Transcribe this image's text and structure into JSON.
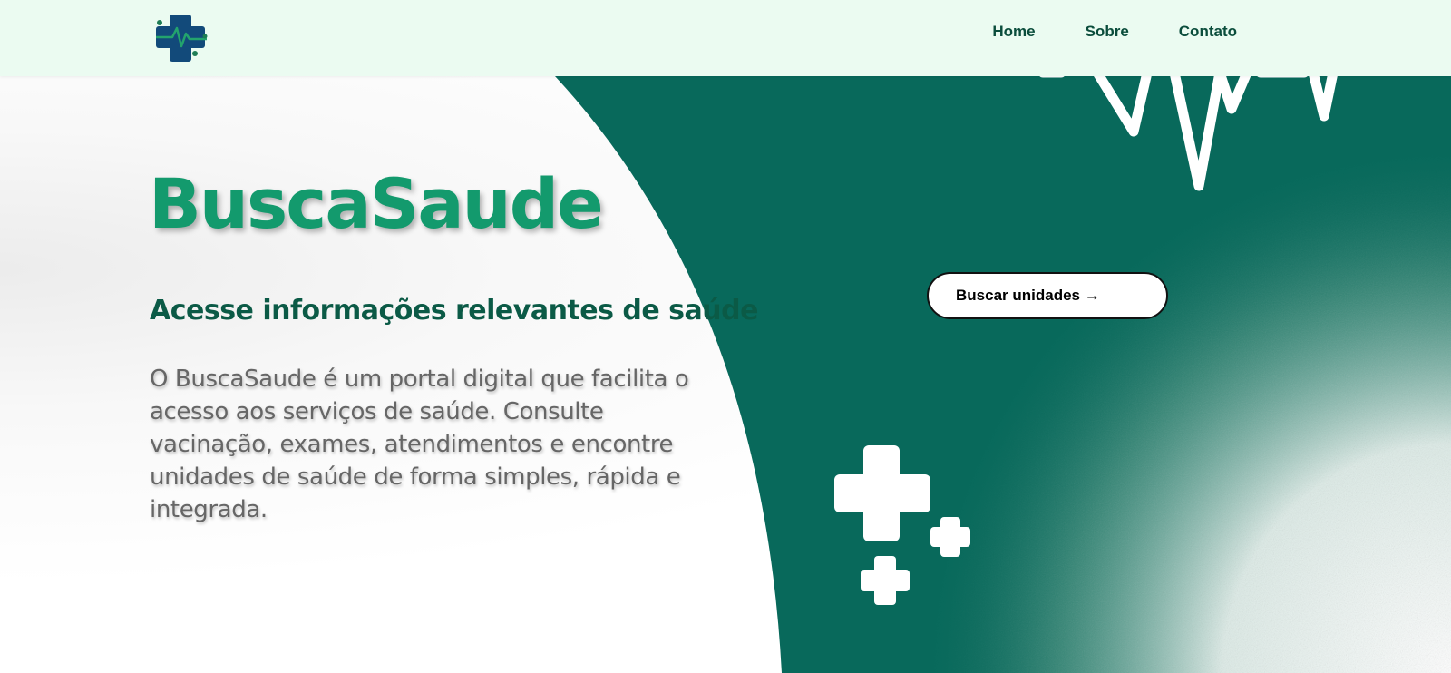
{
  "header": {
    "logo_icon": "medical-cross-heartbeat-icon",
    "nav": [
      {
        "label": "Home"
      },
      {
        "label": "Sobre"
      },
      {
        "label": "Contato"
      }
    ]
  },
  "hero": {
    "title": "BuscaSaude",
    "subtitle": "Acesse informações relevantes de saúde",
    "description": "O BuscaSaude é um portal digital que facilita o acesso aos serviços de saúde. Consulte vacinação, exames, atendimentos e encontre unidades de saúde de forma simples, rápida e integrada.",
    "cta_label": "Buscar unidades →"
  },
  "colors": {
    "navbar_bg": "#ebfbf1",
    "brand_green": "#139a6d",
    "dark_green": "#08695b",
    "nav_text": "#0b4d3c",
    "logo_blue": "#124a7a"
  }
}
